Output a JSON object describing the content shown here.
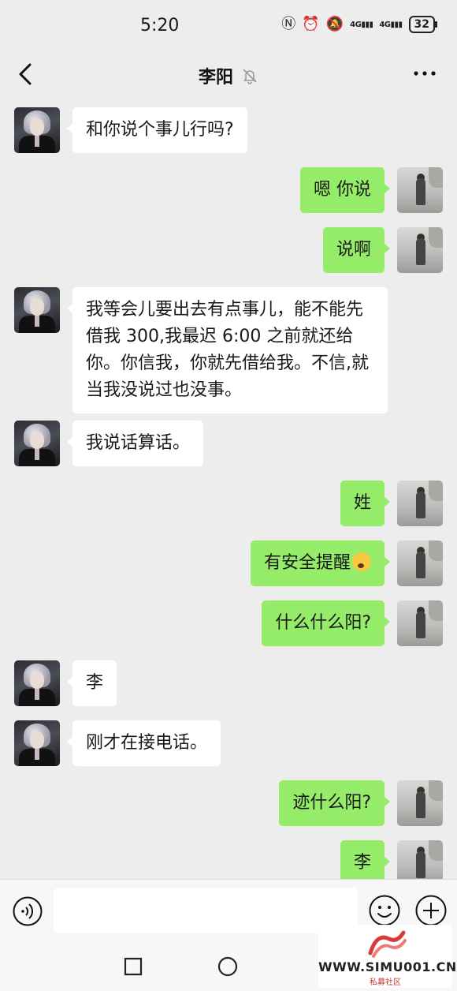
{
  "status_bar": {
    "time": "5:20",
    "network_1": "4G",
    "network_2": "4G",
    "battery": "32"
  },
  "nav": {
    "title": "李阳",
    "back_icon": "chevron-left-icon",
    "mute_icon": "bell-off-icon",
    "more_icon": "more-dots-icon"
  },
  "messages": [
    {
      "side": "left",
      "text": "和你说个事儿行吗?"
    },
    {
      "side": "right",
      "text": "嗯 你说"
    },
    {
      "side": "right",
      "text": "说啊"
    },
    {
      "side": "left",
      "text": "我等会儿要出去有点事儿，能不能先借我 300,我最迟 6:00 之前就还给你。你信我，你就先借给我。不信,就当我没说过也没事。"
    },
    {
      "side": "left",
      "text": "我说话算话。"
    },
    {
      "side": "right",
      "text": "姓"
    },
    {
      "side": "right",
      "text": "有安全提醒",
      "emoji": "worried-face-emoji"
    },
    {
      "side": "right",
      "text": "什么什么阳?"
    },
    {
      "side": "left",
      "text": "李"
    },
    {
      "side": "left",
      "text": "刚才在接电话。"
    },
    {
      "side": "right",
      "text": "迹什么阳?"
    },
    {
      "side": "right",
      "text": "李"
    }
  ],
  "input_bar": {
    "text_value": "",
    "voice_icon": "voice-icon",
    "emoji_icon": "smiley-icon",
    "plus_icon": "plus-circle-icon"
  },
  "system_nav": {
    "recent_icon": "square-icon",
    "home_icon": "circle-icon"
  },
  "watermark": {
    "url": "WWW.SIMU001.CN",
    "subtitle": "私募社区"
  },
  "colors": {
    "background": "#ededed",
    "bubble_right": "#95ec69",
    "bubble_left": "#ffffff"
  }
}
